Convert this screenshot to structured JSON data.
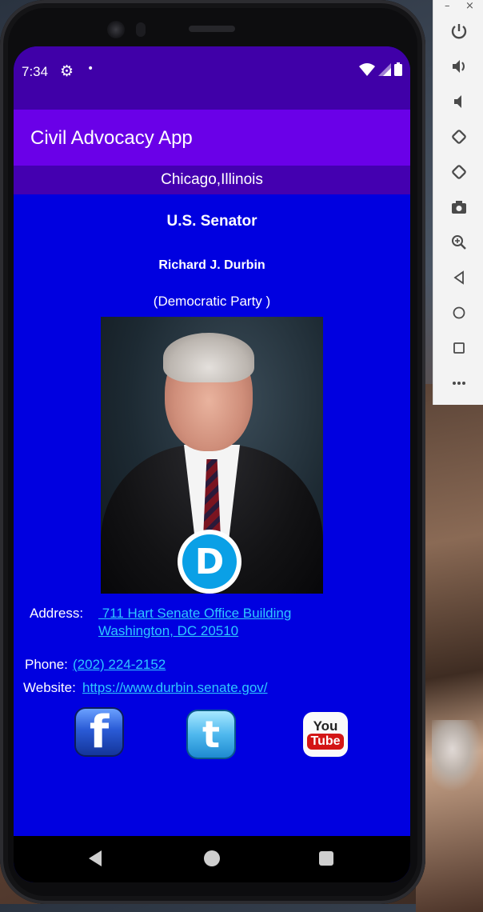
{
  "status_bar": {
    "time": "7:34",
    "icons": [
      "gear-icon",
      "notification-dot-icon",
      "wifi-icon",
      "signal-icon",
      "battery-icon"
    ]
  },
  "app_bar": {
    "title": "Civil Advocacy App"
  },
  "location": "Chicago,Illinois",
  "official": {
    "office": "U.S. Senator",
    "name": "Richard J. Durbin",
    "party": "(Democratic Party )",
    "party_logo_letter": "D",
    "address_label": "Address:",
    "address_line1": " 711 Hart Senate Office Building",
    "address_line2": "Washington, DC 20510",
    "phone_label": "Phone:",
    "phone": "(202) 224-2152",
    "website_label": "Website:",
    "website": "https://www.durbin.senate.gov/"
  },
  "social": {
    "facebook_glyph": "f",
    "twitter_glyph": "t",
    "youtube_top": "You",
    "youtube_bottom": "Tube"
  },
  "emulator_panel": {
    "window_minimize": "–",
    "window_close": "×",
    "tools": [
      "power-icon",
      "volume-up-icon",
      "volume-down-icon",
      "rotate-left-icon",
      "rotate-right-icon",
      "camera-icon",
      "zoom-icon",
      "back-icon",
      "home-icon",
      "overview-icon",
      "more-icon"
    ]
  },
  "colors": {
    "status_bar": "#4000a8",
    "app_bar": "#6a00e8",
    "location_bar": "#4400b0",
    "content_bg": "#0000e0",
    "link": "#2ec8ff"
  }
}
